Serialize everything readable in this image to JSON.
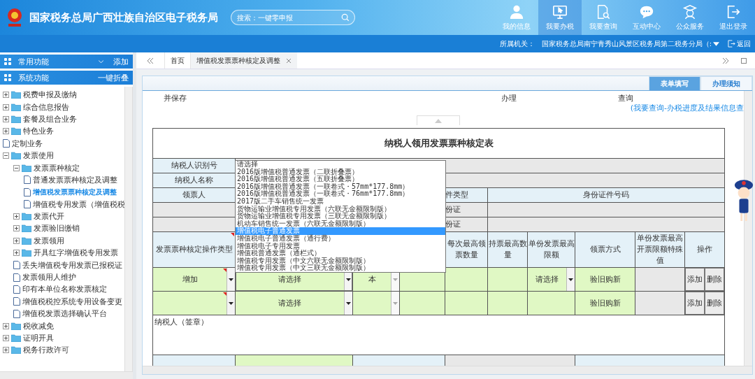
{
  "header": {
    "title": "国家税务总局广西壮族自治区电子税务局",
    "search": {
      "placeholder": "搜索：一键零申报"
    },
    "nav": [
      {
        "label": "我的信息",
        "kind": "person",
        "selected": false
      },
      {
        "label": "我要办税",
        "kind": "monitor",
        "selected": true
      },
      {
        "label": "我要查询",
        "kind": "search-doc",
        "selected": false
      },
      {
        "label": "互动中心",
        "kind": "chat",
        "selected": false
      },
      {
        "label": "公众服务",
        "kind": "service",
        "selected": false
      },
      {
        "label": "退出登录",
        "kind": "exit",
        "selected": false
      }
    ]
  },
  "org_bar": {
    "label": "所属机关：",
    "value": "国家税务总局南宁青秀山风景区税务局第二税务分局（:",
    "back": "返回"
  },
  "sidebar": {
    "common": {
      "title": "常用功能",
      "action": "添加"
    },
    "system": {
      "title": "系统功能",
      "action": "一键折叠"
    },
    "tree": [
      {
        "label": "税费申报及缴纳",
        "kind": "folder",
        "expanded": false,
        "selected": false
      },
      {
        "label": "综合信息报告",
        "kind": "folder",
        "expanded": false,
        "selected": false
      },
      {
        "label": "套餐及组合业务",
        "kind": "folder",
        "expanded": false,
        "selected": false
      },
      {
        "label": "特色业务",
        "kind": "folder",
        "expanded": false,
        "selected": false
      },
      {
        "label": "定制业务",
        "kind": "doc",
        "selected": false
      },
      {
        "label": "发票使用",
        "kind": "folder",
        "expanded": true,
        "selected": false,
        "children": [
          {
            "label": "发票票种核定",
            "kind": "folder",
            "expanded": true,
            "selected": false,
            "children": [
              {
                "label": "普通发票票种核定及调整",
                "kind": "doc",
                "selected": false
              },
              {
                "label": "增值税发票票种核定及调整",
                "kind": "doc",
                "selected": true
              },
              {
                "label": "增值税专用发票（增值税税",
                "kind": "doc",
                "selected": false
              }
            ]
          },
          {
            "label": "发票代开",
            "kind": "folder",
            "expanded": false,
            "selected": false
          },
          {
            "label": "发票验旧缴销",
            "kind": "folder",
            "expanded": false,
            "selected": false
          },
          {
            "label": "发票领用",
            "kind": "folder",
            "expanded": false,
            "selected": false
          },
          {
            "label": "开具红字增值税专用发票",
            "kind": "folder",
            "expanded": false,
            "selected": false
          },
          {
            "label": "丢失增值税专用发票已报税证",
            "kind": "doc",
            "selected": false
          },
          {
            "label": "发票领用人维护",
            "kind": "doc",
            "selected": false
          },
          {
            "label": "印有本单位名称发票核定",
            "kind": "doc",
            "selected": false
          },
          {
            "label": "增值税税控系统专用设备变更",
            "kind": "doc",
            "selected": false
          },
          {
            "label": "增值税发票选择确认平台",
            "kind": "doc",
            "selected": false
          }
        ]
      },
      {
        "label": "税收减免",
        "kind": "folder",
        "expanded": false,
        "selected": false
      },
      {
        "label": "证明开具",
        "kind": "folder",
        "expanded": false,
        "selected": false
      },
      {
        "label": "税务行政许可",
        "kind": "folder",
        "expanded": false,
        "selected": false
      }
    ]
  },
  "tabs": [
    {
      "label": "首页",
      "selected": false,
      "closable": false
    },
    {
      "label": "增值税发票票种核定及调整",
      "selected": true,
      "closable": true
    }
  ],
  "form_tabs": [
    {
      "label": "表单填写",
      "selected": true
    },
    {
      "label": "办理须知",
      "selected": false
    }
  ],
  "steps": [
    "并保存",
    "办理",
    "查询"
  ],
  "progress_link": "(我要查询-办税进度及结果信息查",
  "form": {
    "title": "纳税人领用发票票种核定表",
    "labels": {
      "taxpayer_id": "纳税人识别号",
      "taxpayer_name": "纳税人名称",
      "recipient": "领票人",
      "id_type": "件类型",
      "id_number": "身份证件号码",
      "id_type_row_1": "份证",
      "id_type_row_2": "份证"
    },
    "columns": [
      "发票票种核定操作类型",
      "",
      "",
      "",
      "每次最高领票数量",
      "持票最高数量",
      "单份发票最高限额",
      "领票方式",
      "单份发票最高开票限额特殊值",
      "操作"
    ],
    "rows": [
      {
        "cells": [
          {
            "kind": "select",
            "value": "增加",
            "required": true
          },
          {
            "kind": "select",
            "value": "请选择",
            "focused": true
          },
          {
            "kind": "select",
            "value": "本",
            "disabled": true
          },
          {
            "kind": "blank"
          },
          {
            "kind": "blank"
          },
          {
            "kind": "blank"
          },
          {
            "kind": "select",
            "value": "请选择"
          },
          {
            "kind": "text",
            "value": "验旧购新"
          },
          {
            "kind": "grey"
          },
          {
            "kind": "actions",
            "buttons": [
              "添加",
              "删除"
            ]
          }
        ]
      },
      {
        "cells": [
          {
            "kind": "select",
            "required": true
          },
          {
            "kind": "select",
            "value": "请选择"
          },
          {
            "kind": "select",
            "disabled": true
          },
          {
            "kind": "blank"
          },
          {
            "kind": "blank"
          },
          {
            "kind": "blank"
          },
          {
            "kind": "blank"
          },
          {
            "kind": "text",
            "value": "验旧购新"
          },
          {
            "kind": "grey"
          },
          {
            "kind": "actions",
            "buttons": [
              "添加",
              "删除"
            ]
          }
        ]
      }
    ],
    "signature": "纳税人（签章）",
    "dropdown": [
      {
        "label": "请选择",
        "selected": false
      },
      {
        "label": "2016版增值税普通发票（二联折叠票）",
        "selected": false
      },
      {
        "label": "2016版增值税普通发票（五联折叠票）",
        "selected": false
      },
      {
        "label": "2016版增值税普通发票（一联卷式・57mm*177.8mm）",
        "selected": false
      },
      {
        "label": "2016版增值税普通发票（一联卷式・76mm*177.8mm）",
        "selected": false
      },
      {
        "label": "2017版二手车销售统一发票",
        "selected": false
      },
      {
        "label": "货物运输业增值税专用发票（六联无金额限制版）",
        "selected": false
      },
      {
        "label": "货物运输业增值税专用发票（三联无金额限制版）",
        "selected": false
      },
      {
        "label": "机动车销售统一发票（六联无金额限制版）",
        "selected": false
      },
      {
        "label": "增值税电子普通发票",
        "selected": true
      },
      {
        "label": "增值税电子普通发票（通行费）",
        "selected": false
      },
      {
        "label": "增值税电子专用发票",
        "selected": false
      },
      {
        "label": "增值税普通发票（通栏式）",
        "selected": false
      },
      {
        "label": "增值税专用发票（中文六联无金额限制版）",
        "selected": false
      },
      {
        "label": "增值税专用发票（中文三联无金额限制版）",
        "selected": false
      }
    ]
  }
}
